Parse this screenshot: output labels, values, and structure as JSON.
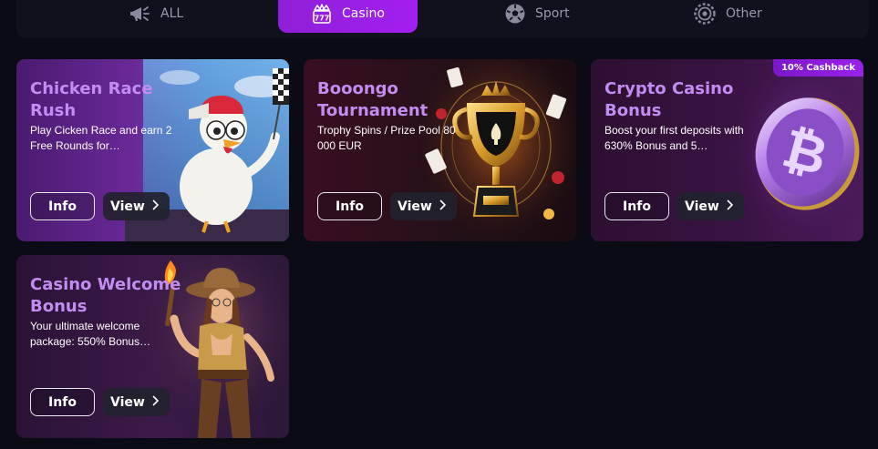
{
  "tabs": [
    {
      "label": "ALL",
      "icon": "megaphone-icon",
      "active": false
    },
    {
      "label": "Casino",
      "icon": "slot-777-icon",
      "active": true
    },
    {
      "label": "Sport",
      "icon": "soccer-ball-icon",
      "active": false
    },
    {
      "label": "Other",
      "icon": "gear-dots-icon",
      "active": false
    }
  ],
  "colors": {
    "accent": "#9a1fe8",
    "title": "#c38cf0",
    "background": "#0b0b16"
  },
  "cards": [
    {
      "title": "Chicken Race Rush",
      "description": "Play Cicken Race and earn 2 Free Rounds for…",
      "info_label": "Info",
      "view_label": "View",
      "image": "chicken-racer-illustration"
    },
    {
      "title": "Booongo Tournament",
      "description": "Trophy Spins / Prize Pool 80 000 EUR",
      "info_label": "Info",
      "view_label": "View",
      "image": "golden-trophy-illustration"
    },
    {
      "title": "Crypto Casino Bonus",
      "description": "Boost your first deposits with 630% Bonus and 5…",
      "info_label": "Info",
      "view_label": "View",
      "image": "bitcoin-coin-illustration",
      "badge": "10% Cashback"
    },
    {
      "title": "Casino Welcome Bonus",
      "description": "Your ultimate welcome package: 550% Bonus…",
      "info_label": "Info",
      "view_label": "View",
      "image": "explorer-woman-illustration"
    }
  ]
}
